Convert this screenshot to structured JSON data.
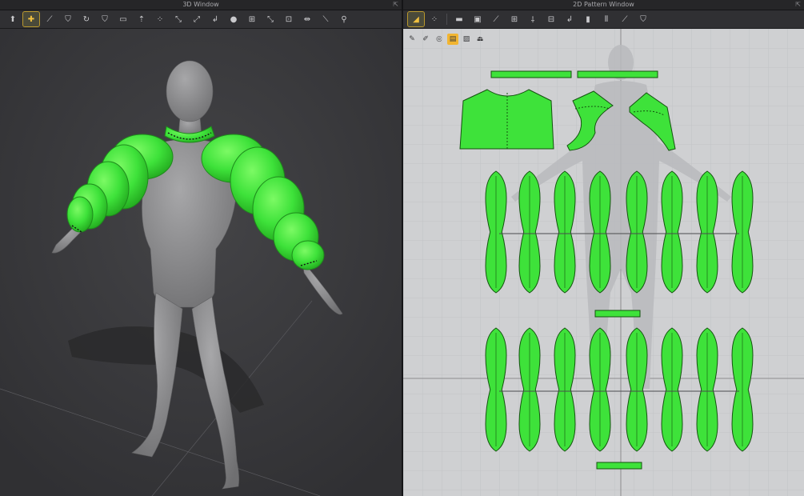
{
  "window_3d": {
    "title": "3D Window"
  },
  "window_2d": {
    "title": "2D Pattern Window"
  },
  "toolbar_3d": [
    "select-mesh-icon",
    "transform-icon",
    "line-tool-icon",
    "garment-icon",
    "fold-icon",
    "arrange-icon",
    "tuck-icon",
    "pin-icon",
    "move-up-icon",
    "dots-icon",
    "pattern-edit-icon",
    "seam-icon",
    "stitch-icon",
    "circle-icon",
    "box-icon",
    "edge-icon",
    "grid-icon",
    "tape-icon",
    "ruler-icon",
    "figure-icon"
  ],
  "subbar_3d": [
    "render-icon",
    "shirt-icon",
    "texture-icon",
    "avatar-icon",
    "sew-icon",
    "flag-icon",
    "skin-icon",
    "fabric-icon",
    "export-icon"
  ],
  "toolbar_2d": [
    "select-transform-icon",
    "edit-point-icon",
    "rectangle-icon",
    "internal-shape-icon",
    "curve-point-icon",
    "internal-rect-icon",
    "fold-line-icon",
    "notch-icon",
    "seam-allowance-icon",
    "stitch-2d-icon",
    "pleat-icon",
    "line-2d-icon",
    "garment-2d-icon"
  ],
  "subbar_2d": [
    "brush-icon",
    "pen-icon",
    "lasso-icon",
    "texture-active-icon",
    "sticker-icon",
    "shade-icon"
  ],
  "colors": {
    "garment_green": "#3ee23a",
    "avatar_gray": "#8c8c8e",
    "active_yellow": "#f2b531"
  }
}
